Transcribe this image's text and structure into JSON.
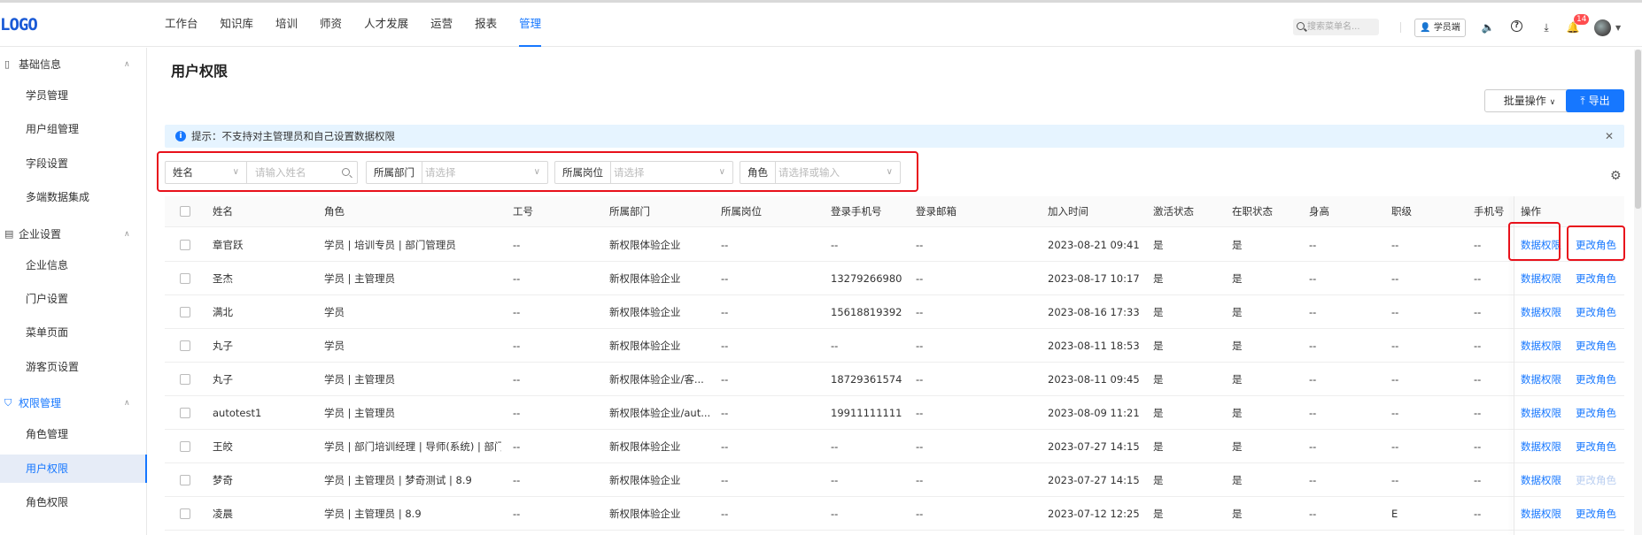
{
  "header": {
    "logo": "LOGO",
    "nav": [
      "工作台",
      "知识库",
      "培训",
      "师资",
      "人才发展",
      "运营",
      "报表",
      "管理"
    ],
    "active_nav": "管理",
    "search_placeholder": "搜索菜单名...",
    "student_button": "学员端",
    "notification_count": "14"
  },
  "sidebar": {
    "groups": [
      {
        "icon": "book-icon",
        "label": "基础信息",
        "items": [
          "学员管理",
          "用户组管理",
          "字段设置",
          "多端数据集成"
        ]
      },
      {
        "icon": "building-icon",
        "label": "企业设置",
        "items": [
          "企业信息",
          "门户设置",
          "菜单页面",
          "游客页设置"
        ]
      },
      {
        "icon": "shield-icon",
        "label": "权限管理",
        "items": [
          "角色管理",
          "用户权限",
          "角色权限"
        ]
      }
    ],
    "active_item": "用户权限"
  },
  "page": {
    "title": "用户权限",
    "batch_button": "批量操作",
    "export_button": "导出",
    "tip": "提示：不支持对主管理员和自己设置数据权限"
  },
  "filters": {
    "name_select": "姓名",
    "name_placeholder": "请输入姓名",
    "dept_label": "所属部门",
    "dept_placeholder": "请选择",
    "post_label": "所属岗位",
    "post_placeholder": "请选择",
    "role_label": "角色",
    "role_placeholder": "请选择或输入"
  },
  "table": {
    "columns": [
      "姓名",
      "角色",
      "工号",
      "所属部门",
      "所属岗位",
      "登录手机号",
      "登录邮箱",
      "加入时间",
      "激活状态",
      "在职状态",
      "身高",
      "职级",
      "手机号",
      "操作"
    ],
    "action_data_perm": "数据权限",
    "action_change_role": "更改角色",
    "rows": [
      {
        "name": "章官跃",
        "role": "学员 | 培训专员 | 部门管理员",
        "no": "--",
        "dept": "新权限体验企业",
        "post": "--",
        "phone": "--",
        "email": "--",
        "join": "2023-08-21 09:41",
        "active": "是",
        "onjob": "是",
        "height": "--",
        "level": "--",
        "mobile": "--",
        "role_disabled": false
      },
      {
        "name": "圣杰",
        "role": "学员 | 主管理员",
        "no": "--",
        "dept": "新权限体验企业",
        "post": "--",
        "phone": "13279266980",
        "email": "--",
        "join": "2023-08-17 10:17",
        "active": "是",
        "onjob": "是",
        "height": "--",
        "level": "--",
        "mobile": "--",
        "role_disabled": false
      },
      {
        "name": "满北",
        "role": "学员",
        "no": "--",
        "dept": "新权限体验企业",
        "post": "--",
        "phone": "15618819392",
        "email": "--",
        "join": "2023-08-16 17:33",
        "active": "是",
        "onjob": "是",
        "height": "--",
        "level": "--",
        "mobile": "--",
        "role_disabled": false
      },
      {
        "name": "丸子",
        "role": "学员",
        "no": "--",
        "dept": "新权限体验企业",
        "post": "--",
        "phone": "--",
        "email": "--",
        "join": "2023-08-11 18:53",
        "active": "是",
        "onjob": "是",
        "height": "--",
        "level": "--",
        "mobile": "--",
        "role_disabled": false
      },
      {
        "name": "丸子",
        "role": "学员 | 主管理员",
        "no": "--",
        "dept": "新权限体验企业/客...",
        "post": "--",
        "phone": "18729361574",
        "email": "--",
        "join": "2023-08-11 09:45",
        "active": "是",
        "onjob": "是",
        "height": "--",
        "level": "--",
        "mobile": "--",
        "role_disabled": false
      },
      {
        "name": "autotest1",
        "role": "学员 | 主管理员",
        "no": "--",
        "dept": "新权限体验企业/aut...",
        "post": "--",
        "phone": "19911111111",
        "email": "--",
        "join": "2023-08-09 11:21",
        "active": "是",
        "onjob": "是",
        "height": "--",
        "level": "--",
        "mobile": "--",
        "role_disabled": false
      },
      {
        "name": "王皎",
        "role": "学员 | 部门培训经理 | 导师(系统) | 部门...",
        "no": "--",
        "dept": "新权限体验企业",
        "post": "--",
        "phone": "--",
        "email": "--",
        "join": "2023-07-27 14:15",
        "active": "是",
        "onjob": "是",
        "height": "--",
        "level": "--",
        "mobile": "--",
        "role_disabled": false
      },
      {
        "name": "梦奇",
        "role": "学员 | 主管理员 | 梦奇测试 | 8.9",
        "no": "--",
        "dept": "新权限体验企业",
        "post": "--",
        "phone": "--",
        "email": "--",
        "join": "2023-07-27 14:15",
        "active": "是",
        "onjob": "是",
        "height": "--",
        "level": "--",
        "mobile": "--",
        "role_disabled": true
      },
      {
        "name": "凌晨",
        "role": "学员 | 主管理员 | 8.9",
        "no": "--",
        "dept": "新权限体验企业",
        "post": "--",
        "phone": "--",
        "email": "--",
        "join": "2023-07-12 12:25",
        "active": "是",
        "onjob": "是",
        "height": "--",
        "level": "E",
        "mobile": "--",
        "role_disabled": false
      }
    ]
  }
}
